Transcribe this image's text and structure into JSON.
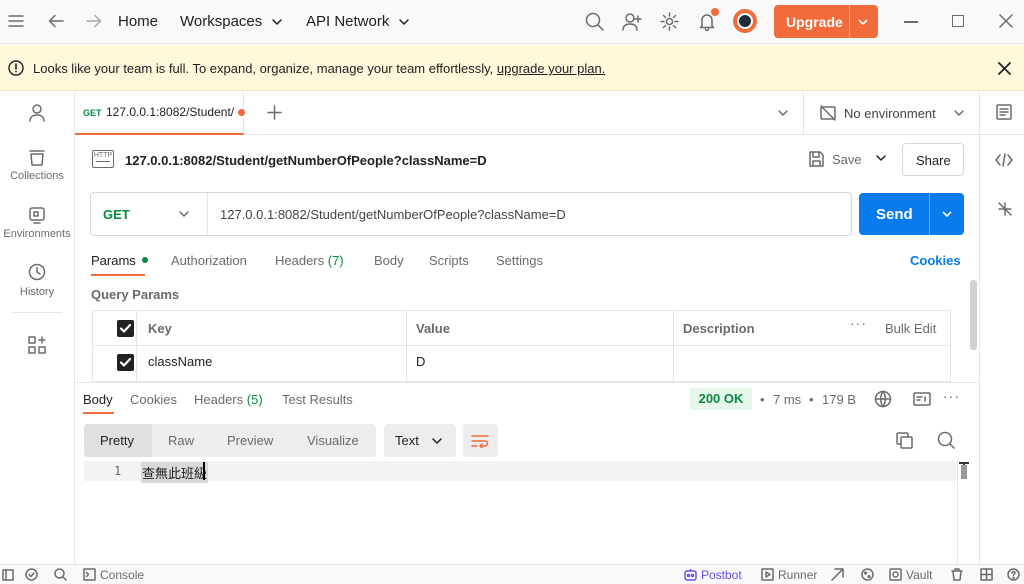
{
  "topbar": {
    "home": "Home",
    "workspaces": "Workspaces",
    "api_network": "API Network",
    "upgrade": "Upgrade"
  },
  "banner": {
    "text": "Looks like your team is full. To expand, organize, manage your team effortlessly, ",
    "link": "upgrade your plan."
  },
  "sidebar": {
    "items": [
      {
        "label": "",
        "icon": "user-icon"
      },
      {
        "label": "Collections",
        "icon": "collections-icon"
      },
      {
        "label": "Environments",
        "icon": "environments-icon"
      },
      {
        "label": "History",
        "icon": "history-icon"
      },
      {
        "label": "",
        "icon": "apps-icon"
      }
    ]
  },
  "tabs": [
    {
      "method": "GET",
      "title": "127.0.0.1:8082/Student/",
      "unsaved": true
    }
  ],
  "environment": {
    "label": "No environment"
  },
  "request": {
    "title": "127.0.0.1:8082/Student/getNumberOfPeople?className=D",
    "save": "Save",
    "share": "Share",
    "method": "GET",
    "url": "127.0.0.1:8082/Student/getNumberOfPeople?className=D",
    "send": "Send",
    "tabs": {
      "params": "Params",
      "authorization": "Authorization",
      "headers": "Headers",
      "headers_count": "(7)",
      "body": "Body",
      "scripts": "Scripts",
      "settings": "Settings"
    },
    "cookies": "Cookies",
    "query_params_title": "Query Params",
    "table": {
      "headers": {
        "key": "Key",
        "value": "Value",
        "description": "Description",
        "bulk_edit": "Bulk Edit"
      },
      "rows": [
        {
          "checked": true,
          "key": "className",
          "value": "D",
          "description": ""
        }
      ]
    }
  },
  "response": {
    "tabs": {
      "body": "Body",
      "cookies": "Cookies",
      "headers": "Headers",
      "headers_count": "(5)",
      "test_results": "Test Results"
    },
    "status": "200 OK",
    "time": "7 ms",
    "size": "179 B",
    "formats": [
      "Pretty",
      "Raw",
      "Preview",
      "Visualize"
    ],
    "active_format": "Pretty",
    "content_type": "Text",
    "lines": [
      {
        "number": "1",
        "text": "查無此班級"
      }
    ]
  },
  "footer": {
    "console": "Console",
    "postbot": "Postbot",
    "runner": "Runner",
    "vault": "Vault"
  },
  "colors": {
    "accent": "#f26b3a",
    "send": "#097bed",
    "get": "#0a8a3e",
    "banner": "#fff8db"
  }
}
